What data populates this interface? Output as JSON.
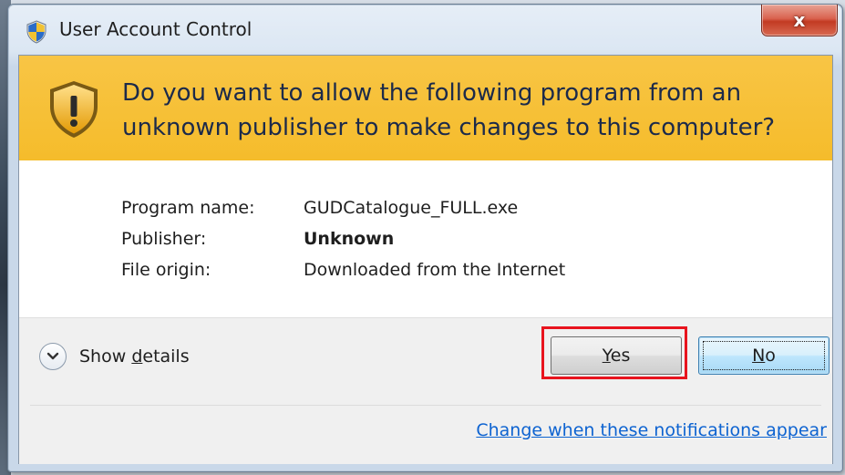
{
  "window": {
    "title": "User Account Control",
    "close_label": "x"
  },
  "banner": {
    "line1": "Do you want to allow the following program from an",
    "line2": "unknown publisher to make changes to this computer?"
  },
  "details": {
    "program_name": {
      "label": "Program name:",
      "value": "GUDCatalogue_FULL.exe"
    },
    "publisher": {
      "label": "Publisher:",
      "value": "Unknown"
    },
    "file_origin": {
      "label": "File origin:",
      "value": "Downloaded from the Internet"
    }
  },
  "actions": {
    "show_details": {
      "prefix": "Show ",
      "accel": "d",
      "suffix": "etails"
    },
    "yes": {
      "accel": "Y",
      "rest": "es"
    },
    "no": {
      "accel": "N",
      "rest": "o"
    },
    "change_link": "Change when these notifications appear"
  },
  "colors": {
    "banner_bg": "#f5bc2b",
    "highlight": "#e8141e",
    "link": "#0d63d1"
  },
  "icons": {
    "title_icon": "uac-shield-icon",
    "banner_icon": "warning-shield-icon",
    "expand_icon": "chevron-down-icon"
  }
}
